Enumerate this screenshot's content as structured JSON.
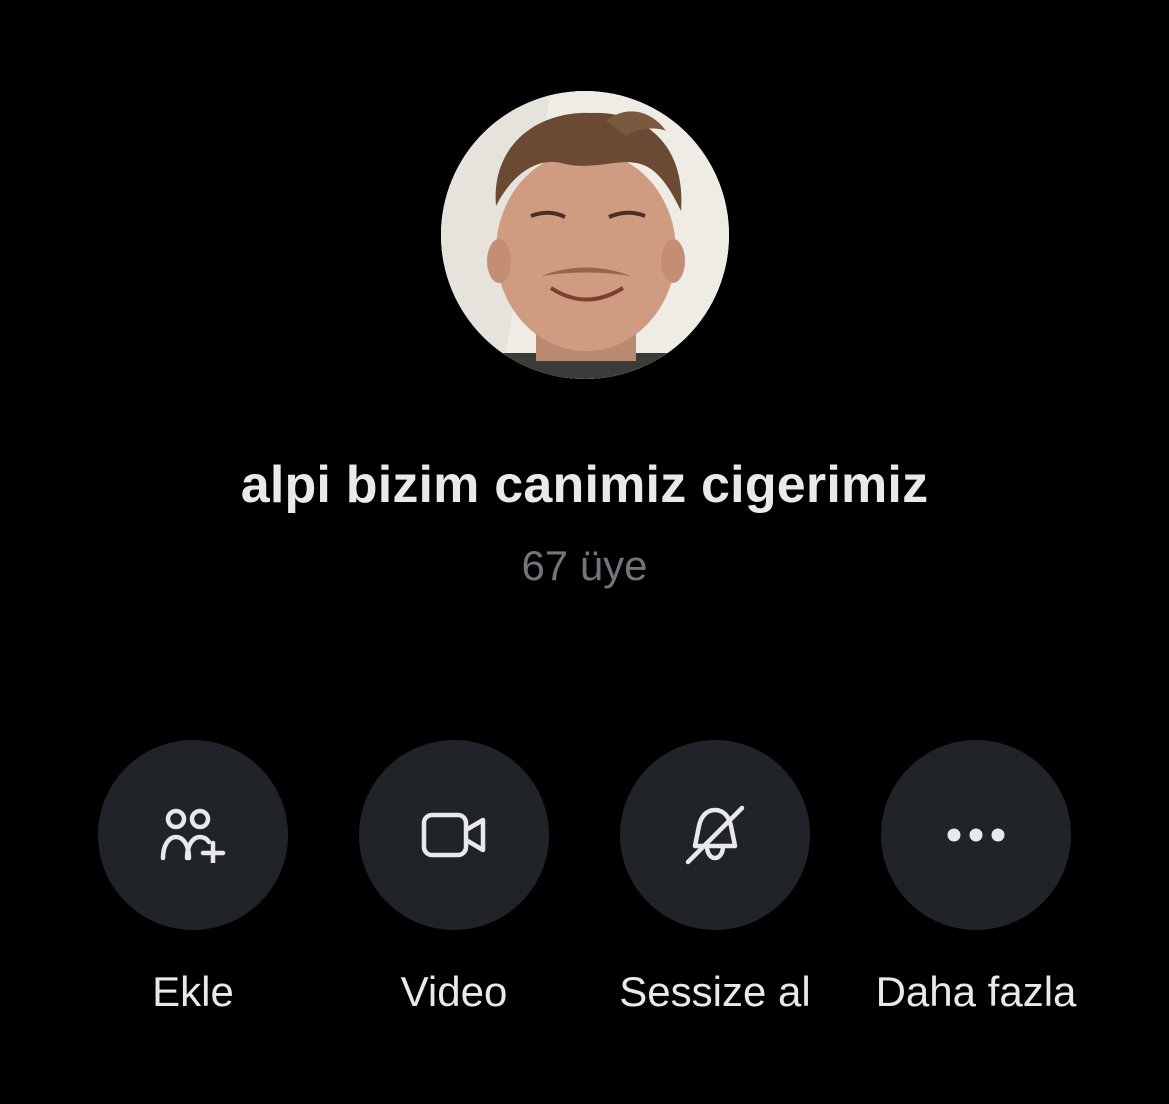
{
  "group": {
    "name": "alpi bizim canimiz cigerimiz",
    "member_count": "67 üye",
    "avatar": "profile-photo-smiling-man"
  },
  "actions": [
    {
      "label": "Ekle",
      "icon": "add-people-icon"
    },
    {
      "label": "Video",
      "icon": "video-camera-icon"
    },
    {
      "label": "Sessize al",
      "icon": "bell-off-icon"
    },
    {
      "label": "Daha fazla",
      "icon": "more-dots-icon"
    }
  ],
  "colors": {
    "background": "#000000",
    "button_bg": "#202327",
    "text_primary": "#e7e9ea",
    "text_secondary": "#71767b"
  }
}
